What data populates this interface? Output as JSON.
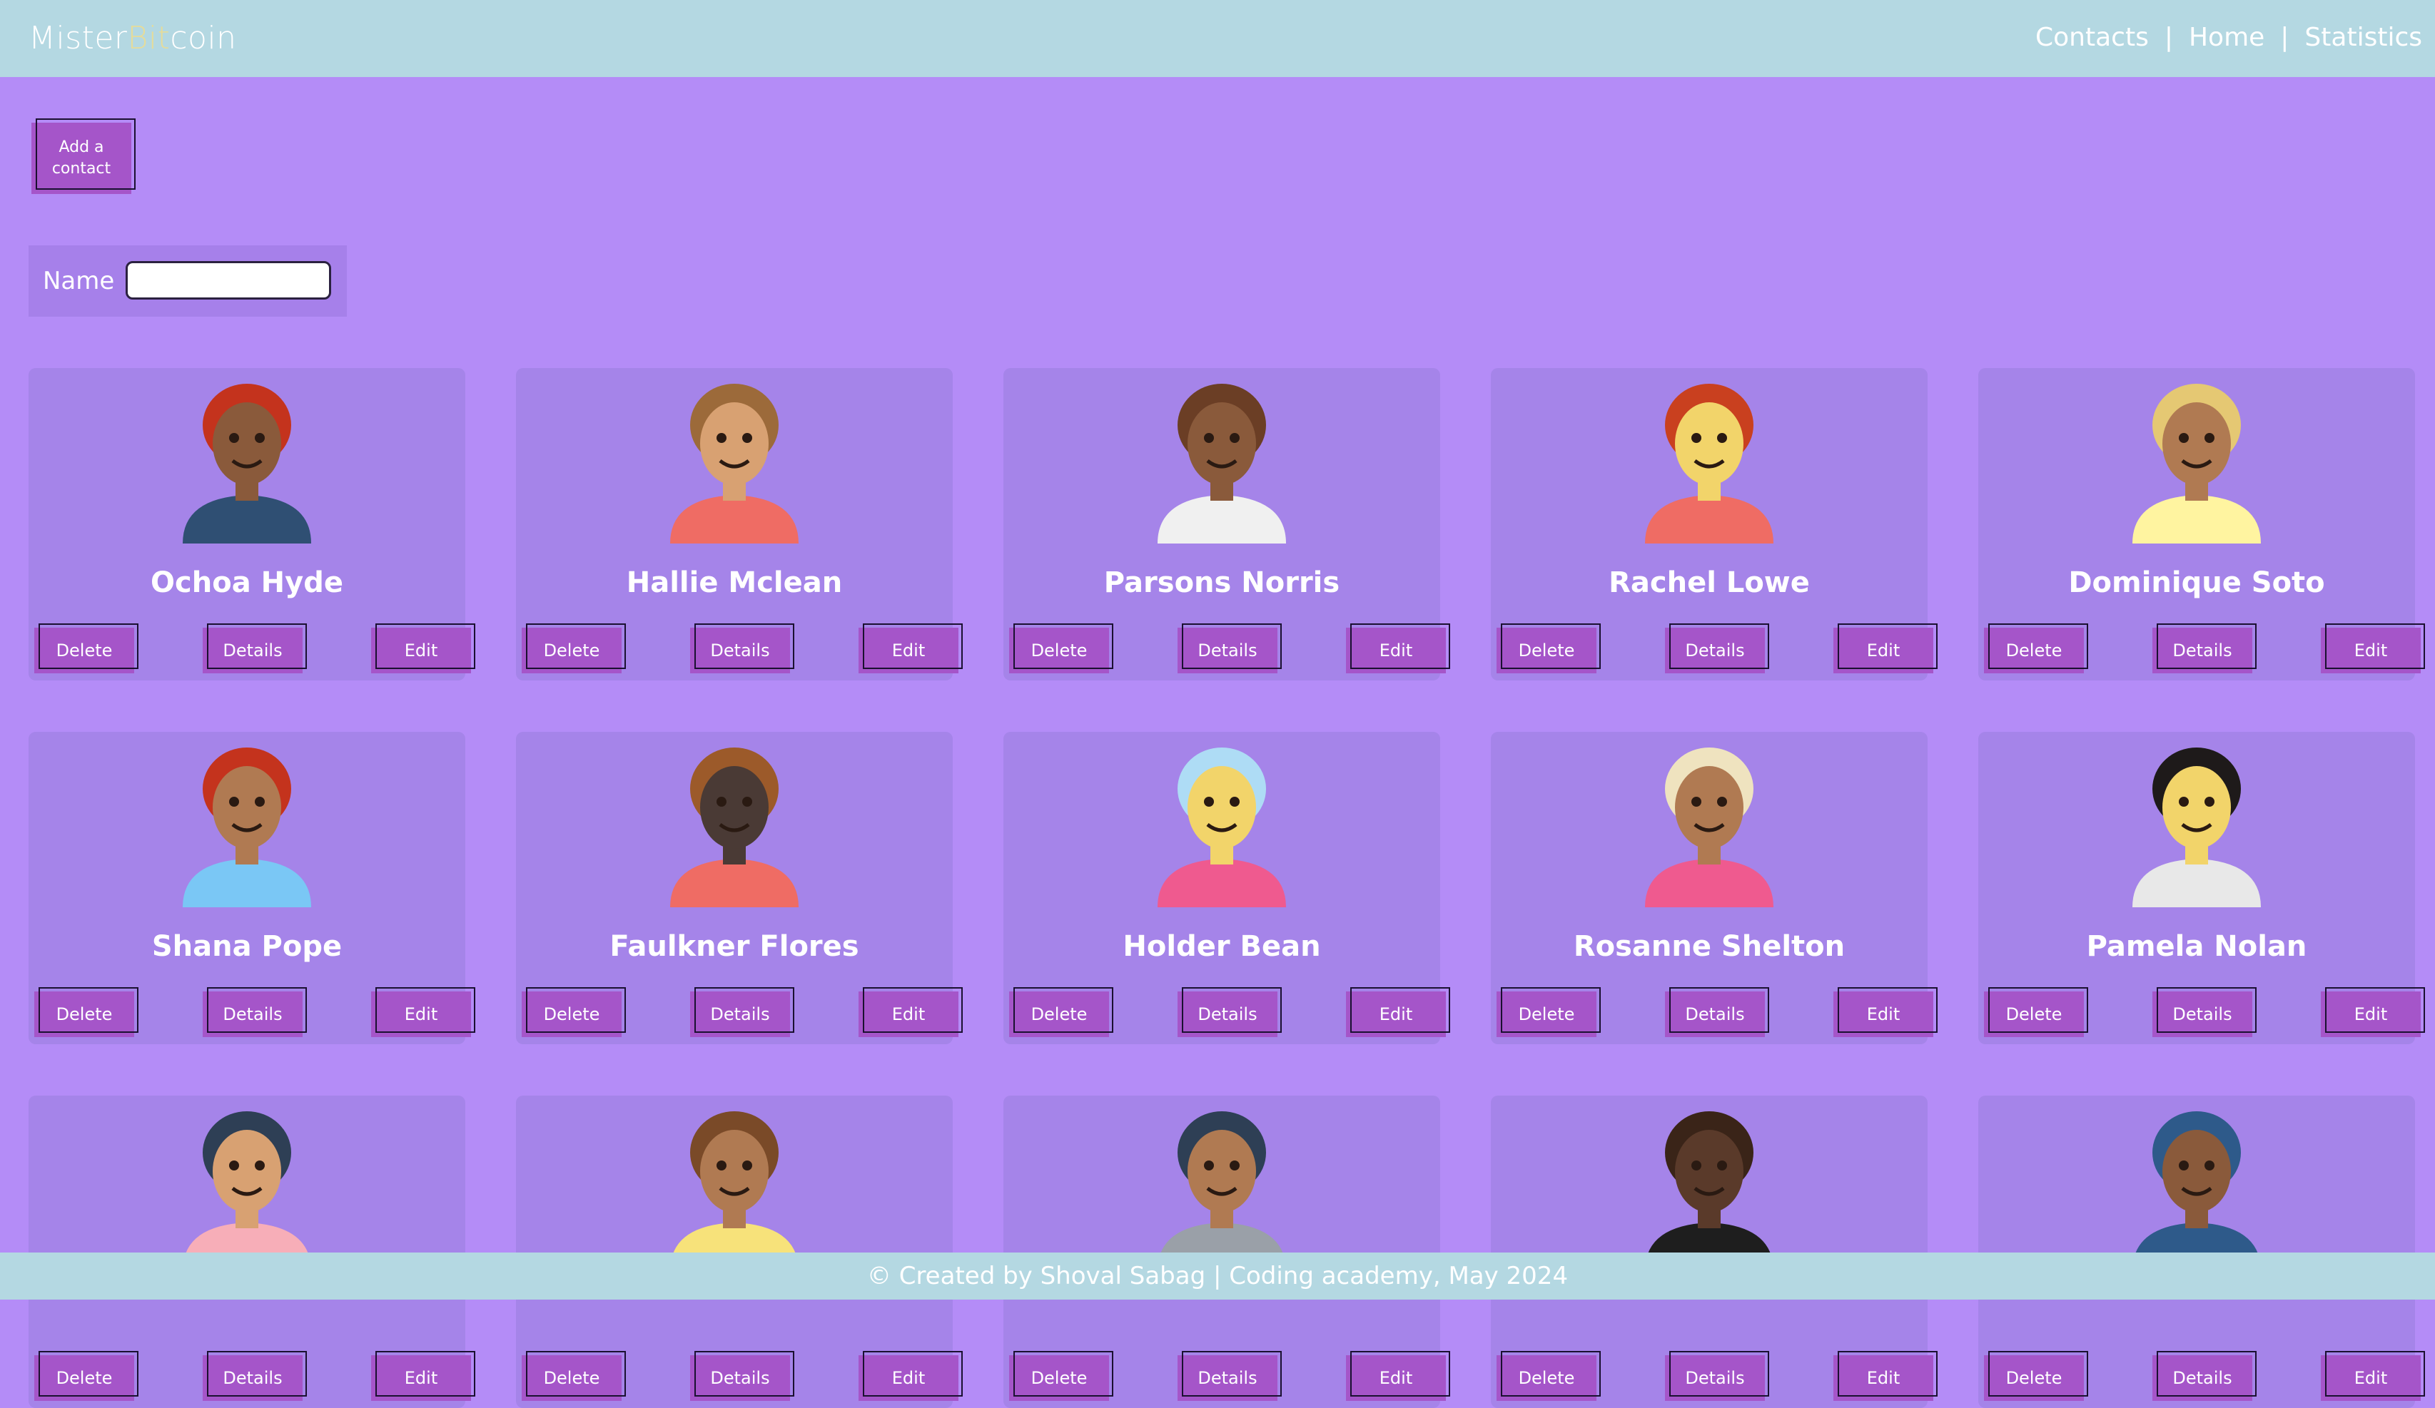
{
  "header": {
    "logo": {
      "part1": "Mister",
      "part2": "Bit",
      "part3": "coin"
    },
    "nav": [
      "Contacts",
      "Home",
      "Statistics"
    ]
  },
  "add_contact_label": "Add a contact",
  "filter": {
    "label": "Name",
    "value": ""
  },
  "buttons": {
    "delete": "Delete",
    "details": "Details",
    "edit": "Edit"
  },
  "contacts": [
    {
      "name": "Ochoa Hyde",
      "hair": "#c4331d",
      "skin": "#8a5a3b",
      "shirt": "#2f4f73"
    },
    {
      "name": "Hallie Mclean",
      "hair": "#9c6a3a",
      "skin": "#d8a172",
      "shirt": "#ef6c64"
    },
    {
      "name": "Parsons Norris",
      "hair": "#6b3e25",
      "skin": "#8a5a3b",
      "shirt": "#f0f0f0"
    },
    {
      "name": "Rachel Lowe",
      "hair": "#c9401f",
      "skin": "#f2d46a",
      "shirt": "#ef6c64"
    },
    {
      "name": "Dominique Soto",
      "hair": "#e5c873",
      "skin": "#b07a52",
      "shirt": "#fff4a0"
    },
    {
      "name": "Shana Pope",
      "hair": "#c4331d",
      "skin": "#b07a52",
      "shirt": "#7ac7f5"
    },
    {
      "name": "Faulkner Flores",
      "hair": "#9c5a2a",
      "skin": "#4a3a35",
      "shirt": "#ef6c64"
    },
    {
      "name": "Holder Bean",
      "hair": "#aedcf5",
      "skin": "#f2d46a",
      "shirt": "#ef5a8f"
    },
    {
      "name": "Rosanne Shelton",
      "hair": "#efe3bf",
      "skin": "#b07a52",
      "shirt": "#ef5a8f"
    },
    {
      "name": "Pamela Nolan",
      "hair": "#1e1a1a",
      "skin": "#f2d46a",
      "shirt": "#e8e8e8"
    },
    {
      "name": "",
      "hair": "#2e3f55",
      "skin": "#d8a172",
      "shirt": "#f7aeb8"
    },
    {
      "name": "",
      "hair": "#7a4a28",
      "skin": "#b07a52",
      "shirt": "#f7e27a"
    },
    {
      "name": "",
      "hair": "#2e3f55",
      "skin": "#b07a52",
      "shirt": "#9aa0a8"
    },
    {
      "name": "",
      "hair": "#3a2418",
      "skin": "#5a3a2a",
      "shirt": "#1e1e1e"
    },
    {
      "name": "",
      "hair": "#2e5a8a",
      "skin": "#8a5a3b",
      "shirt": "#2e5a8a"
    }
  ],
  "footer": "© Created by Shoval Sabag | Coding academy, May 2024"
}
